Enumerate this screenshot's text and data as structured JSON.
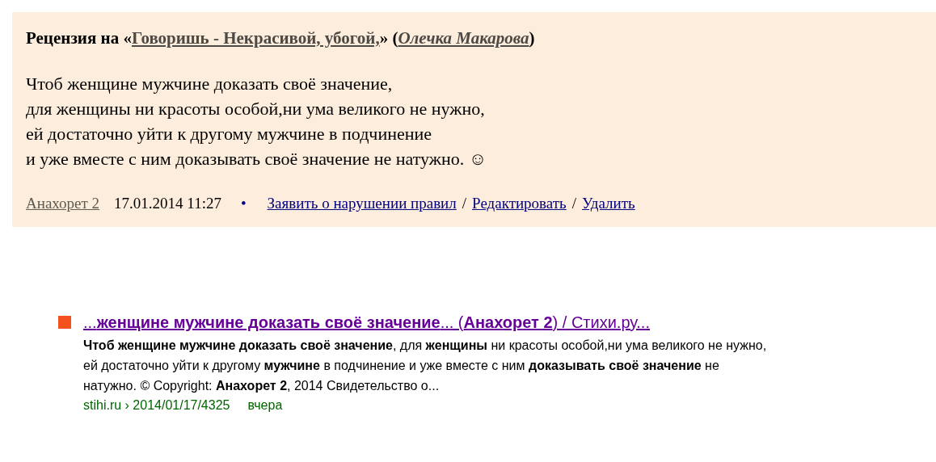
{
  "review": {
    "heading_prefix": "Рецензия на «",
    "work_title": "Говоришь - Некрасивой, убогой,",
    "heading_middle": "» (",
    "author": "Олечка Макарова",
    "heading_suffix": ")",
    "poem_lines": [
      "Чтоб женщине мужчине доказать своё значение,",
      "для женщины ни красоты особой,ни ума великого не нужно,",
      "ей достаточно уйти к другому мужчине в подчинение",
      "и уже вместе с ним доказывать своё значение не натужно. ☺"
    ],
    "reviewer": "Анахорет 2",
    "datetime": "17.01.2014 11:27",
    "bullet": "•",
    "actions": [
      {
        "kind": "link",
        "text": "Заявить о нарушении правил"
      },
      {
        "kind": "separator",
        "text": "/"
      },
      {
        "kind": "link",
        "text": "Редактировать"
      },
      {
        "kind": "separator",
        "text": "/"
      },
      {
        "kind": "link",
        "text": "Удалить"
      }
    ]
  },
  "search_result": {
    "title": "...**женщине мужчине доказать своё значение**... (**Анахорет 2**) / Стихи.ру...",
    "snippet": "**Чтоб женщине мужчине доказать своё значение**, для **женщины** ни красоты особой,ни ума великого не нужно, ей достаточно уйти к другому **мужчине** в подчинение и уже вместе с ним **доказывать своё значение** не натужно. © Copyright: **Анахорет 2**, 2014 Свидетельство о...",
    "url": "stihi.ru › 2014/01/17/4325",
    "age": "вчера"
  }
}
